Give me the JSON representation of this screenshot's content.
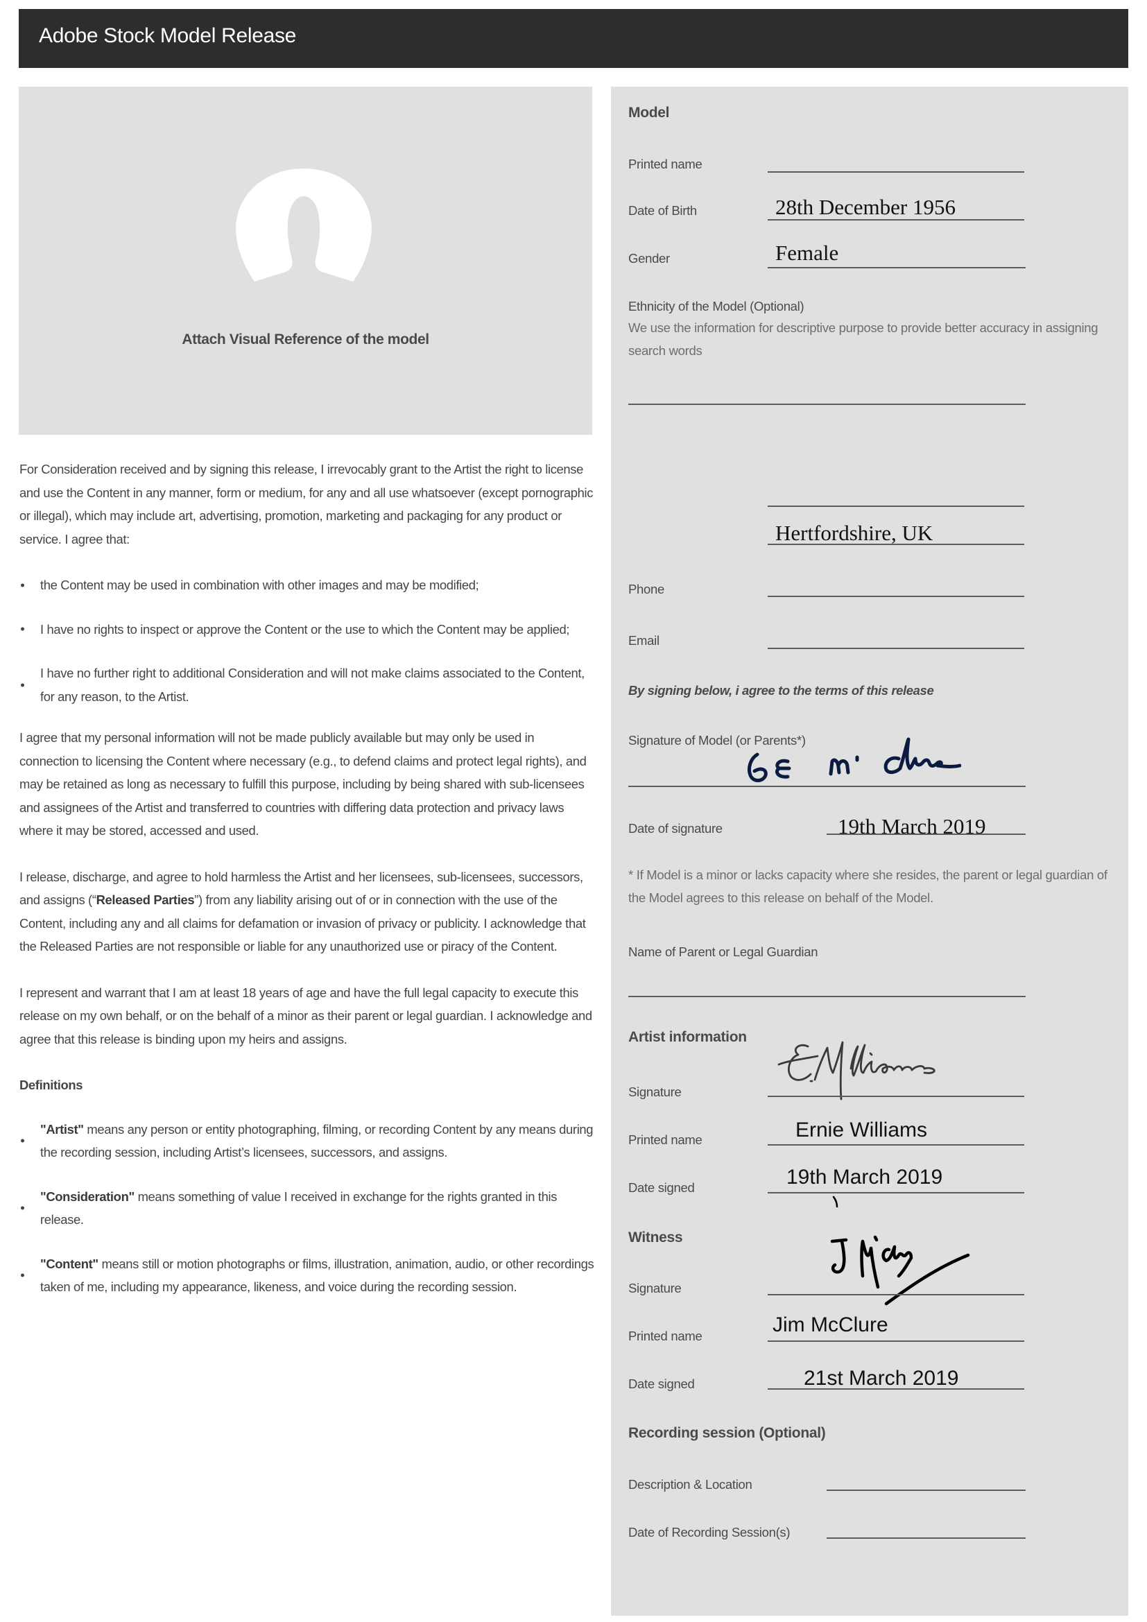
{
  "header": {
    "title": "Adobe Stock Model Release"
  },
  "photo": {
    "caption": "Attach Visual Reference of the model",
    "icon": "avatar-placeholder-icon"
  },
  "terms": {
    "intro": "For Consideration received and by signing this release, I irrevocably grant to the Artist the right to license and use the Content in any manner, form or medium, for any and all use whatsoever (except pornographic or illegal), which may include art, advertising, promotion, marketing and packaging for any product or service. I agree that:",
    "agree_items": [
      "the Content may be used in combination with other images and may be modified;",
      "I have no rights to inspect or approve the Content or the use to which the Content may be applied;",
      "I have no further right to additional Consideration and will not make claims associated to the Content, for any reason, to the Artist."
    ],
    "privacy": "I agree that my personal information will not be made publicly available but may only be used in connection to licensing the Content where necessary (e.g., to defend claims and protect legal rights), and may be retained as long as necessary to fulfill this purpose, including by being shared with sub-licensees and assignees of the Artist and transferred to countries with differing data protection and privacy laws where it may be stored, accessed and used.",
    "release_before": "I release, discharge, and agree to hold harmless the Artist and her licensees, sub-licensees, successors, and assigns (“",
    "release_bold": "Released Parties",
    "release_after": "”) from any liability arising out of or in connection with the use of the Content, including any and all claims for defamation or invasion of privacy or publicity. I acknowledge that the Released Parties are not responsible or liable for any unauthorized use or piracy of the Content.",
    "warrant": "I represent and warrant that I am at least 18 years of age and have the full legal capacity to execute this release on my own behalf, or on the behalf of a minor as their parent or legal guardian. I acknowledge and agree that this release is binding upon my heirs and assigns.",
    "definitions_title": "Definitions",
    "definitions": [
      {
        "term": "\"Artist\"",
        "text": " means any person or entity photographing, filming, or recording Content by any means during the recording session, including Artist’s licensees, successors, and assigns."
      },
      {
        "term": "\"Consideration\"",
        "text": " means something of value I received in exchange for the rights granted in this release."
      },
      {
        "term": "\"Content\"",
        "text": " means still or motion photographs or films, illustration, animation, audio, or other recordings taken of me, including my appearance, likeness, and voice during the recording session."
      }
    ]
  },
  "model": {
    "heading": "Model",
    "printed_name_label": "Printed name",
    "printed_name_value": "",
    "dob_label": "Date of Birth",
    "dob_value": "28th December 1956",
    "gender_label": "Gender",
    "gender_value": "Female",
    "ethnicity_label": "Ethnicity of the Model (Optional)",
    "ethnicity_help": "We use the information for descriptive purpose to provide better accuracy in assigning search words",
    "ethnicity_value": "",
    "address_line1_value": "",
    "address_line2_value": "Hertfordshire, UK",
    "phone_label": "Phone",
    "phone_value": "",
    "email_label": "Email",
    "email_value": "",
    "agree_statement": "By signing below, i agree to the terms of this release",
    "signature_label": "Signature of Model (or Parents*)",
    "signature_text": "G E Mc Clure",
    "date_of_signature_label": "Date of signature",
    "date_of_signature_value": "19th March 2019",
    "minor_note": "* If Model is a minor or lacks capacity where she resides, the parent or legal guardian of the Model agrees to this release on behalf of the Model.",
    "guardian_label": "Name of Parent or Legal Guardian",
    "guardian_value": ""
  },
  "artist": {
    "heading": "Artist information",
    "signature_label": "Signature",
    "signature_text": "E. Williams",
    "printed_name_label": "Printed name",
    "printed_name_value": "Ernie Williams",
    "date_signed_label": "Date signed",
    "date_signed_value": "19th March 2019"
  },
  "witness": {
    "heading": "Witness",
    "signature_label": "Signature",
    "signature_text": "J McClure",
    "printed_name_label": "Printed name",
    "printed_name_value": "Jim McClure",
    "date_signed_label": "Date signed",
    "date_signed_value": "21st March 2019"
  },
  "recording": {
    "heading": "Recording session (Optional)",
    "description_label": "Description & Location",
    "description_value": "",
    "date_label": "Date of Recording Session(s)",
    "date_value": ""
  },
  "colors": {
    "header_bg": "#2d2d2d",
    "panel_bg": "#e0e0e0",
    "model_signature_ink": "#0b1a40",
    "artist_signature_ink": "#3a3a3a",
    "witness_signature_ink": "#000000"
  }
}
